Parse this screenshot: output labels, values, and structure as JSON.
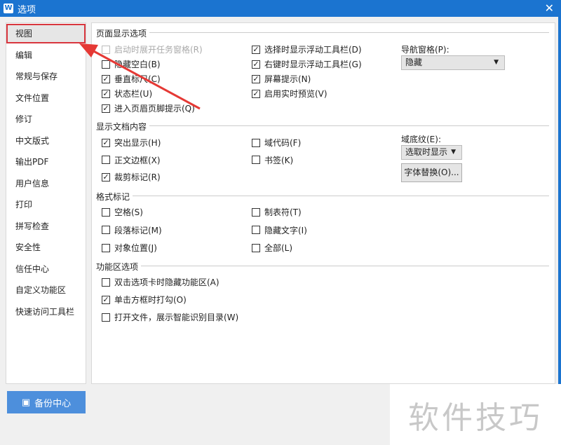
{
  "window": {
    "title": "选项",
    "close": "✕"
  },
  "sidebar": {
    "items": [
      "视图",
      "编辑",
      "常规与保存",
      "文件位置",
      "修订",
      "中文版式",
      "输出PDF",
      "用户信息",
      "打印",
      "拼写检查",
      "安全性",
      "信任中心",
      "自定义功能区",
      "快速访问工具栏"
    ],
    "selected": 0
  },
  "sections": {
    "page_display": {
      "title": "页面显示选项",
      "left": [
        {
          "label": "启动时展开任务窗格(R)",
          "checked": false,
          "disabled": true
        },
        {
          "label": "隐藏空白(B)",
          "checked": false
        },
        {
          "label": "垂直标尺(C)",
          "checked": true
        },
        {
          "label": "状态栏(U)",
          "checked": true
        },
        {
          "label": "进入页眉页脚提示(Q)",
          "checked": true
        }
      ],
      "right": [
        {
          "label": "选择时显示浮动工具栏(D)",
          "checked": true
        },
        {
          "label": "右键时显示浮动工具栏(G)",
          "checked": true
        },
        {
          "label": "屏幕提示(N)",
          "checked": true
        },
        {
          "label": "启用实时预览(V)",
          "checked": true
        }
      ],
      "nav_label": "导航窗格(P):",
      "nav_value": "隐藏"
    },
    "doc_content": {
      "title": "显示文档内容",
      "left": [
        {
          "label": "突出显示(H)",
          "checked": true
        },
        {
          "label": "正文边框(X)",
          "checked": false
        },
        {
          "label": "裁剪标记(R)",
          "checked": true
        }
      ],
      "right": [
        {
          "label": "域代码(F)",
          "checked": false
        },
        {
          "label": "书签(K)",
          "checked": false
        }
      ],
      "shading_label": "域底纹(E):",
      "shading_value": "选取时显示",
      "font_sub_button": "字体替换(O)..."
    },
    "format_marks": {
      "title": "格式标记",
      "left": [
        {
          "label": "空格(S)",
          "checked": false
        },
        {
          "label": "段落标记(M)",
          "checked": false
        },
        {
          "label": "对象位置(J)",
          "checked": false
        }
      ],
      "right": [
        {
          "label": "制表符(T)",
          "checked": false
        },
        {
          "label": "隐藏文字(I)",
          "checked": false
        },
        {
          "label": "全部(L)",
          "checked": false
        }
      ]
    },
    "ribbon": {
      "title": "功能区选项",
      "left": [
        {
          "label": "双击选项卡时隐藏功能区(A)",
          "checked": false
        },
        {
          "label": "单击方框时打勾(O)",
          "checked": true
        },
        {
          "label": "打开文件，展示智能识别目录(W)",
          "checked": false
        }
      ]
    }
  },
  "footer": {
    "backup_button": "备份中心"
  },
  "watermark": "软件技巧",
  "colors": {
    "titlebar": "#1b74d0",
    "highlight": "#d9363e",
    "backup": "#4d8fdc"
  }
}
